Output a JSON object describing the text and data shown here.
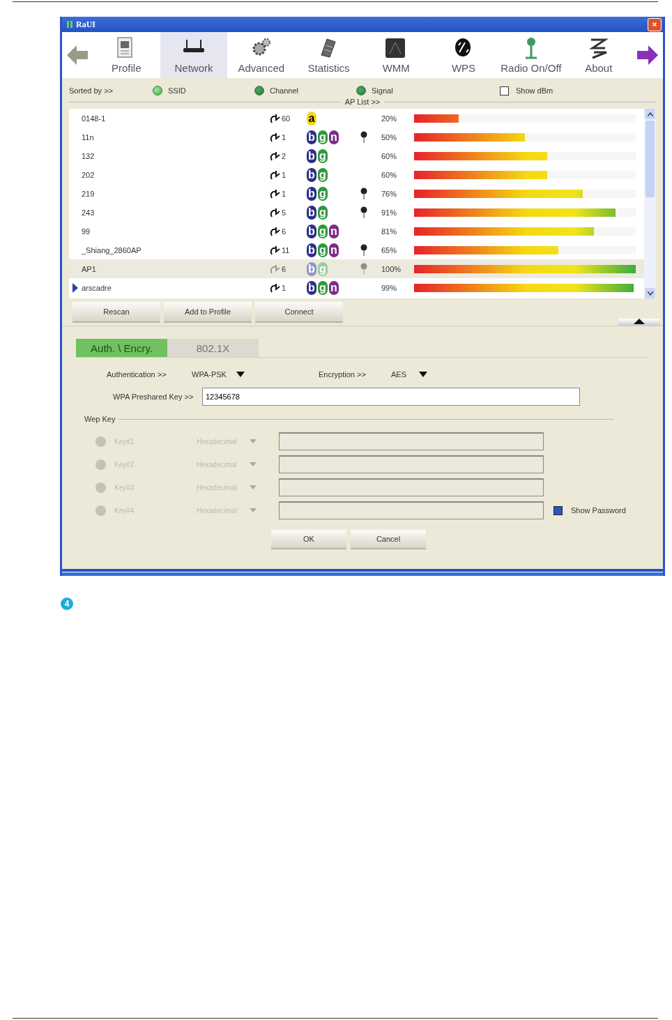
{
  "window": {
    "title": "RaUI"
  },
  "toolbar": [
    {
      "label": "Profile",
      "selected": false
    },
    {
      "label": "Network",
      "selected": true
    },
    {
      "label": "Advanced",
      "selected": false
    },
    {
      "label": "Statistics",
      "selected": false
    },
    {
      "label": "WMM",
      "selected": false
    },
    {
      "label": "WPS",
      "selected": false
    },
    {
      "label": "Radio On/Off",
      "selected": false
    },
    {
      "label": "About",
      "selected": false
    }
  ],
  "sort_bar": {
    "label": "Sorted by >>",
    "options": [
      {
        "label": "SSID",
        "selected": true
      },
      {
        "label": "Channel",
        "selected": false
      },
      {
        "label": "Signal",
        "selected": false
      }
    ],
    "show_dbm": {
      "label": "Show dBm",
      "checked": false
    }
  },
  "ap_list": {
    "title": "AP List >>",
    "rows": [
      {
        "ssid": "0148-1",
        "channel": "60",
        "bands": [
          {
            "label": "a",
            "color": "#f2d81c"
          }
        ],
        "secured": false,
        "signal": "20%",
        "level": 0.2,
        "selected": false,
        "connected": false
      },
      {
        "ssid": "11n",
        "channel": "1",
        "bands": [
          {
            "label": "b",
            "color": "#2c2f86"
          },
          {
            "label": "g",
            "color": "#2e9a3c"
          },
          {
            "label": "n",
            "color": "#7d2c86"
          }
        ],
        "secured": true,
        "signal": "50%",
        "level": 0.5,
        "selected": false,
        "connected": false
      },
      {
        "ssid": "132",
        "channel": "2",
        "bands": [
          {
            "label": "b",
            "color": "#2c2f86"
          },
          {
            "label": "g",
            "color": "#2e9a3c"
          }
        ],
        "secured": false,
        "signal": "60%",
        "level": 0.6,
        "selected": false,
        "connected": false
      },
      {
        "ssid": "202",
        "channel": "1",
        "bands": [
          {
            "label": "b",
            "color": "#2c2f86"
          },
          {
            "label": "g",
            "color": "#2e9a3c"
          }
        ],
        "secured": false,
        "signal": "60%",
        "level": 0.6,
        "selected": false,
        "connected": false
      },
      {
        "ssid": "219",
        "channel": "1",
        "bands": [
          {
            "label": "b",
            "color": "#2c2f86"
          },
          {
            "label": "g",
            "color": "#2e9a3c"
          }
        ],
        "secured": true,
        "signal": "76%",
        "level": 0.76,
        "selected": false,
        "connected": false
      },
      {
        "ssid": "243",
        "channel": "5",
        "bands": [
          {
            "label": "b",
            "color": "#2c2f86"
          },
          {
            "label": "g",
            "color": "#2e9a3c"
          }
        ],
        "secured": true,
        "signal": "91%",
        "level": 0.91,
        "selected": false,
        "connected": false
      },
      {
        "ssid": "99",
        "channel": "6",
        "bands": [
          {
            "label": "b",
            "color": "#2c2f86"
          },
          {
            "label": "g",
            "color": "#2e9a3c"
          },
          {
            "label": "n",
            "color": "#7d2c86"
          }
        ],
        "secured": false,
        "signal": "81%",
        "level": 0.81,
        "selected": false,
        "connected": false
      },
      {
        "ssid": "_Shiang_2860AP",
        "channel": "11",
        "bands": [
          {
            "label": "b",
            "color": "#2c2f86"
          },
          {
            "label": "g",
            "color": "#2e9a3c"
          },
          {
            "label": "n",
            "color": "#7d2c86"
          }
        ],
        "secured": true,
        "signal": "65%",
        "level": 0.65,
        "selected": false,
        "connected": false
      },
      {
        "ssid": "AP1",
        "channel": "6",
        "bands": [
          {
            "label": "b",
            "color": "#9496c6"
          },
          {
            "label": "g",
            "color": "#9ccb9f"
          }
        ],
        "secured": true,
        "signal": "100%",
        "level": 1.0,
        "selected": true,
        "connected": false
      },
      {
        "ssid": "arscadre",
        "channel": "1",
        "bands": [
          {
            "label": "b",
            "color": "#2c2f86"
          },
          {
            "label": "g",
            "color": "#2e9a3c"
          },
          {
            "label": "n",
            "color": "#7d2c86"
          }
        ],
        "secured": false,
        "signal": "99%",
        "level": 0.99,
        "selected": false,
        "connected": true
      }
    ]
  },
  "list_buttons": [
    "Rescan",
    "Add to Profile",
    "Connect"
  ],
  "tabs": [
    {
      "label": "Auth. \\ Encry.",
      "selected": true
    },
    {
      "label": "802.1X",
      "selected": false
    }
  ],
  "security": {
    "authentication": {
      "label": "Authentication >>",
      "value": "WPA-PSK"
    },
    "encryption": {
      "label": "Encryption >>",
      "value": "AES"
    },
    "preshared_key": {
      "label": "WPA Preshared Key >>",
      "value": "12345678"
    }
  },
  "wep": {
    "title": "Wep Key",
    "keys": [
      {
        "label": "Key#1",
        "format": "Hexadecimal",
        "disabled": true
      },
      {
        "label": "Key#2",
        "format": "Hexadecimal",
        "disabled": true
      },
      {
        "label": "Key#3",
        "format": "Hexadecimal",
        "disabled": true
      },
      {
        "label": "Key#4",
        "format": "Hexadecimal",
        "disabled": true
      }
    ],
    "show_password": {
      "label": "Show Password",
      "checked": true
    }
  },
  "dialog_buttons": [
    "OK",
    "Cancel"
  ],
  "step_marker": "4"
}
